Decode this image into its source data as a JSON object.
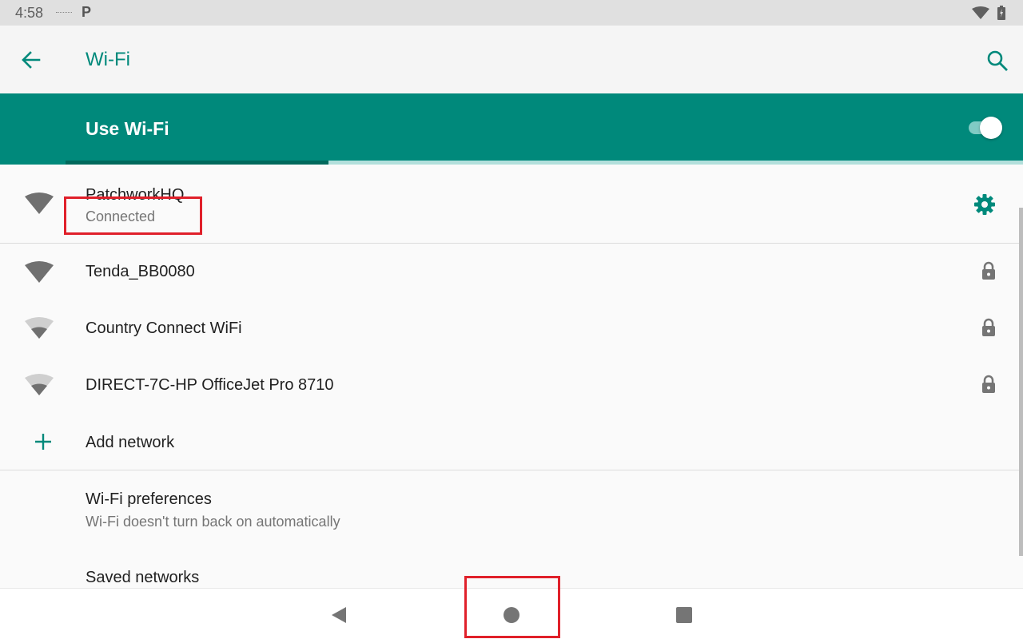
{
  "status_bar": {
    "time": "4:58",
    "icons": [
      "notification-icon",
      "parking-app-icon",
      "wifi-icon",
      "battery-icon"
    ]
  },
  "app_bar": {
    "title": "Wi-Fi",
    "back_icon": "arrow-back-icon",
    "search_icon": "search-icon"
  },
  "master_switch": {
    "label": "Use Wi-Fi",
    "enabled": true
  },
  "networks": [
    {
      "name": "PatchworkHQ",
      "status": "Connected",
      "signal": "full",
      "trailing_icon": "gear-icon"
    },
    {
      "name": "Tenda_BB0080",
      "status": "",
      "signal": "full",
      "trailing_icon": "lock-icon"
    },
    {
      "name": "Country Connect WiFi",
      "status": "",
      "signal": "weak",
      "trailing_icon": "lock-icon"
    },
    {
      "name": "DIRECT-7C-HP OfficeJet Pro 8710",
      "status": "",
      "signal": "weak",
      "trailing_icon": "lock-icon"
    }
  ],
  "add_network": {
    "label": "Add network",
    "icon": "plus-icon"
  },
  "preferences": {
    "title": "Wi-Fi preferences",
    "summary": "Wi-Fi doesn't turn back on automatically"
  },
  "saved_networks": {
    "title": "Saved networks"
  },
  "nav_bar": {
    "buttons": [
      "back-triangle-icon",
      "home-circle-icon",
      "recents-square-icon"
    ]
  },
  "colors": {
    "accent": "#00897b",
    "accent_dark": "#00695c",
    "status_bar": "#e0e0e0",
    "background": "#fafafa",
    "highlight": "#e0202a"
  }
}
